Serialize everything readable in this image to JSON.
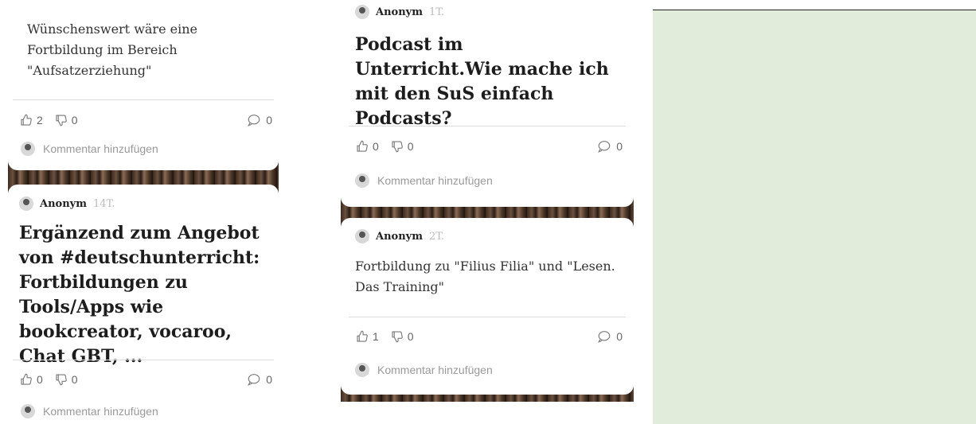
{
  "column1": {
    "card_a": {
      "body": "Wünschenswert wäre eine Fortbildung im Bereich \"Aufsatzerziehung\"",
      "likes": "2",
      "dislikes": "0",
      "comments": "0",
      "add_comment": "Kommentar hinzufügen"
    },
    "card_b": {
      "author": "Anonym",
      "time": "14T.",
      "title": "Ergänzend zum Angebot von #deutschunterricht: Fortbildungen zu Tools/Apps wie bookcreator, vocaroo, Chat GBT, ...",
      "likes": "0",
      "dislikes": "0",
      "comments": "0",
      "add_comment": "Kommentar hinzufügen"
    }
  },
  "column2": {
    "card_a": {
      "author": "Anonym",
      "time": "1T.",
      "title": "Podcast im Unterricht.Wie mache ich mit den SuS einfach Podcasts?",
      "likes": "0",
      "dislikes": "0",
      "comments": "0",
      "add_comment": "Kommentar hinzufügen"
    },
    "card_b": {
      "author": "Anonym",
      "time": "2T.",
      "body": "Fortbildung zu \"Filius Filia\" und \"Lesen. Das Training\"",
      "likes": "1",
      "dislikes": "0",
      "comments": "0",
      "add_comment": "Kommentar hinzufügen"
    }
  },
  "colors": {
    "right_panel": "#e1edda",
    "wood_dark": "#3b2a1f",
    "card": "#ffffff"
  },
  "icons": [
    "thumbs-up-icon",
    "thumbs-down-icon",
    "comment-icon",
    "avatar-icon"
  ]
}
